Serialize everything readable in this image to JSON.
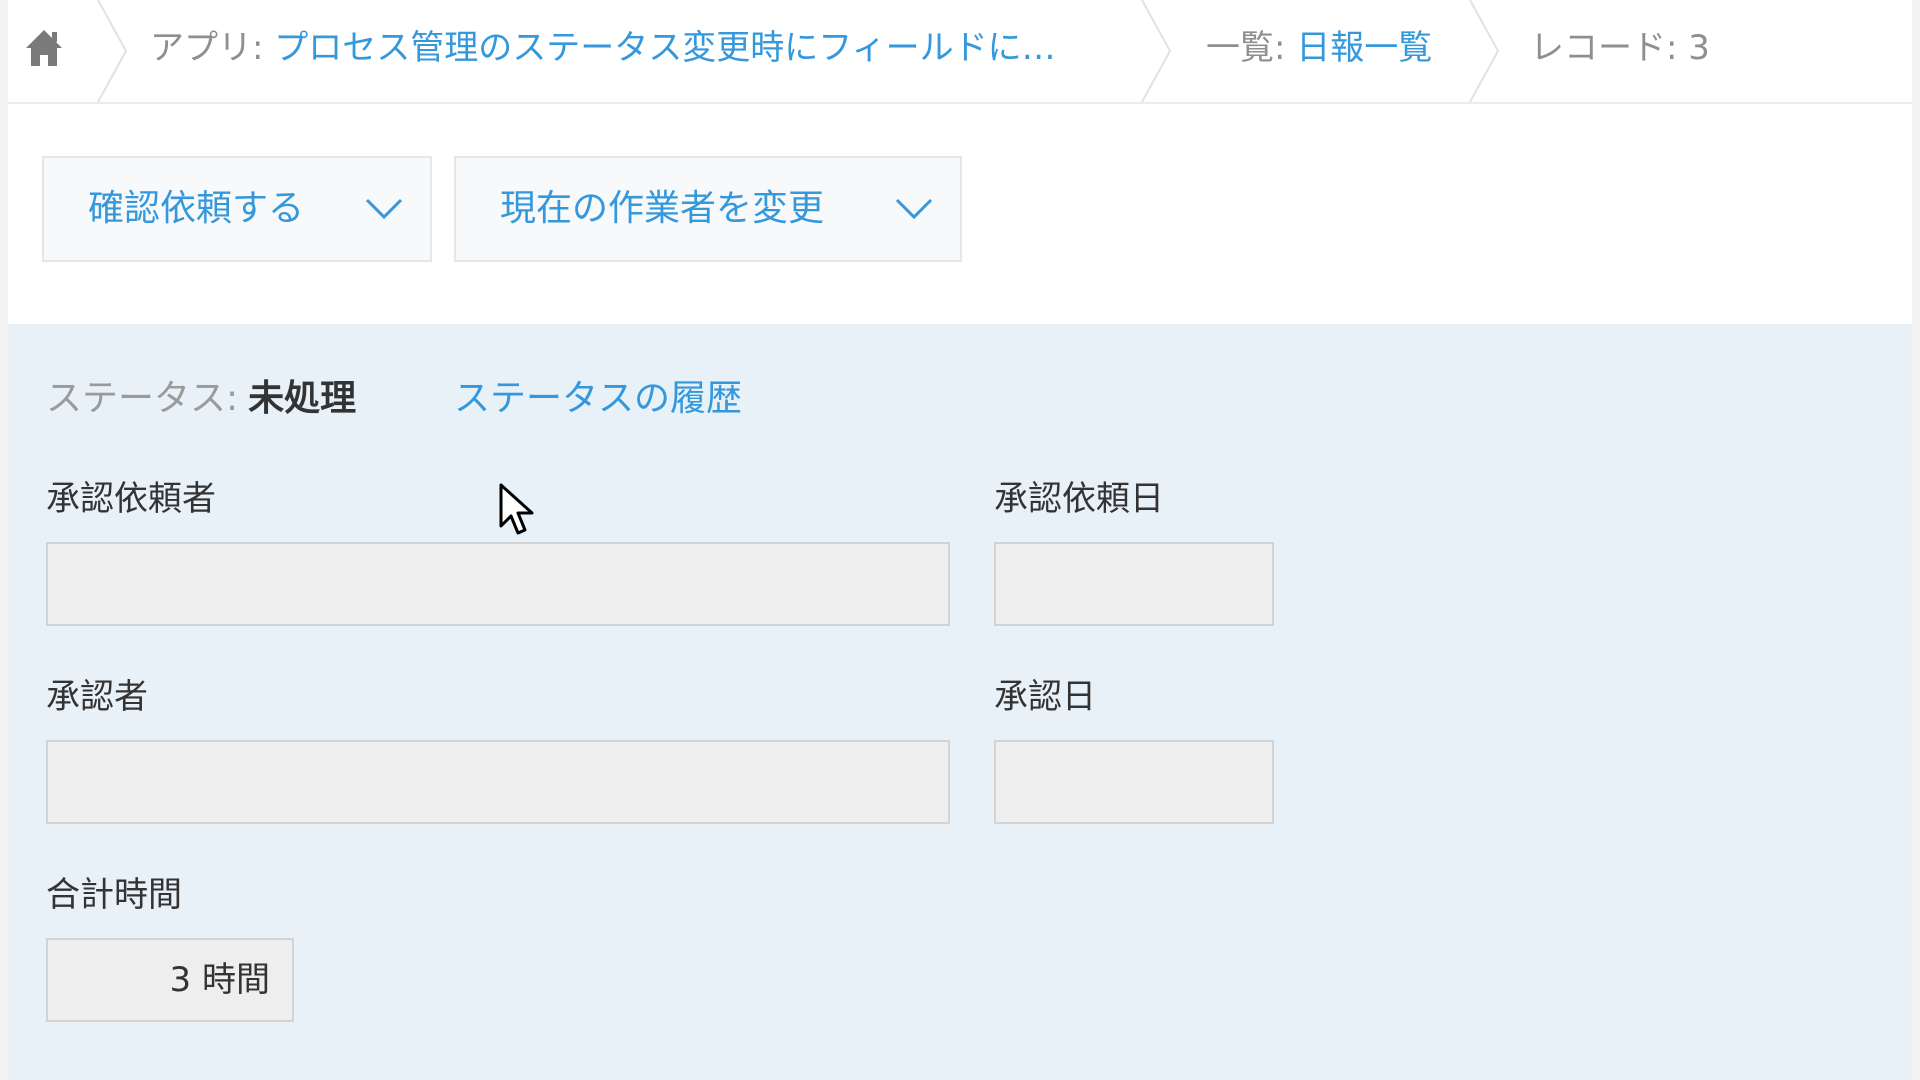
{
  "breadcrumb": {
    "home_icon": "home-icon",
    "app_prefix": "アプリ: ",
    "app_name": "プロセス管理のステータス変更時にフィールドに…",
    "view_prefix": "一覧: ",
    "view_name": "日報一覧",
    "record_label": "レコード: 3"
  },
  "actions": {
    "request_confirm": "確認依頼する",
    "change_assignee": "現在の作業者を変更"
  },
  "status": {
    "label": "ステータス:",
    "value": "未処理",
    "history_link": "ステータスの履歴"
  },
  "fields": {
    "requester": {
      "label": "承認依頼者",
      "value": ""
    },
    "request_date": {
      "label": "承認依頼日",
      "value": ""
    },
    "approver": {
      "label": "承認者",
      "value": ""
    },
    "approval_date": {
      "label": "承認日",
      "value": ""
    },
    "total_time": {
      "label": "合計時間",
      "value": "3 時間"
    }
  },
  "colors": {
    "link": "#3498db",
    "body_background": "#e8f1f8",
    "field_background": "#eeeeee"
  }
}
